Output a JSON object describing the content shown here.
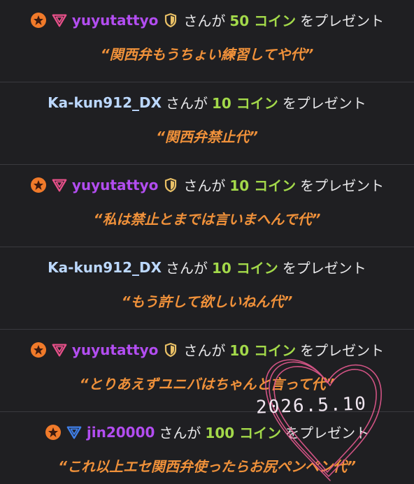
{
  "colors": {
    "background": "#1f1f22",
    "divider": "#3a3a3f",
    "username_purple": "#b24df0",
    "username_blue": "#bcd8ff",
    "coins": "#a3d94a",
    "message": "#f0913a",
    "heart": "#e5598f"
  },
  "gifts": [
    {
      "badges": [
        "star-badge-icon",
        "gem-badge-icon"
      ],
      "username": "yuyutattyo",
      "shield": "shield-icon",
      "san": "さんが",
      "amount": "50 コイン",
      "suffix": "をプレゼント",
      "message": "“関西弁もうちょい練習してや代”"
    },
    {
      "badges": [],
      "username": "Ka-kun912_DX",
      "san": "さんが",
      "amount": "10 コイン",
      "suffix": "をプレゼント",
      "message": "“関西弁禁止代”"
    },
    {
      "badges": [
        "star-badge-icon",
        "gem-badge-icon"
      ],
      "username": "yuyutattyo",
      "shield": "shield-icon",
      "san": "さんが",
      "amount": "10 コイン",
      "suffix": "をプレゼント",
      "message": "“私は禁止とまでは言いまへんで代”"
    },
    {
      "badges": [],
      "username": "Ka-kun912_DX",
      "san": "さんが",
      "amount": "10 コイン",
      "suffix": "をプレゼント",
      "message": "“もう許して欲しいねん代”"
    },
    {
      "badges": [
        "star-badge-icon",
        "gem-badge-icon"
      ],
      "username": "yuyutattyo",
      "shield": "shield-icon",
      "san": "さんが",
      "amount": "10 コイン",
      "suffix": "をプレゼント",
      "message": "“とりあえずユニバはちゃんと言って代”"
    },
    {
      "badges": [
        "star-badge-icon",
        "triangle-badge-icon"
      ],
      "username": "jin20000",
      "san": "さんが",
      "amount": "100 コイン",
      "suffix": "をプレゼント",
      "message": "“これ以上エセ関西弁使ったらお尻ペンペン代”"
    }
  ],
  "stamp": {
    "date": "2026.5.10",
    "decoration": "heart-doodle-icon"
  }
}
